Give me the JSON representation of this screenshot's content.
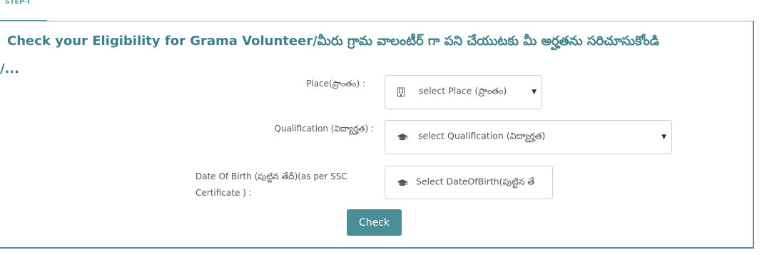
{
  "step": {
    "label": "STEP-I"
  },
  "heading": {
    "text": "Check your Eligibility for Grama Volunteer/మీరు గ్రామ వాలంటీర్ గా పని చేయుటకు మీ అర్హతను సరిచూసుకోండి",
    "continuation": "/..."
  },
  "form": {
    "place": {
      "label": "Place(ప్రాంతం) :",
      "icon": "building-icon",
      "selected": "select Place (ప్రాంతం)"
    },
    "qualification": {
      "label": "Qualification (విద్యార్హత) :",
      "icon": "graduation-cap-icon",
      "selected": "select Qualification (విద్యార్హత)"
    },
    "dob": {
      "label": "Date Of Birth (పుట్టిన తేదీ)(as per SSC Certificate ) :",
      "icon": "graduation-cap-icon",
      "placeholder": "Select DateOfBirth(పుట్టిన తే"
    },
    "submit_label": "Check"
  },
  "colors": {
    "accent": "#4a8f97",
    "heading": "#3d7f88"
  }
}
